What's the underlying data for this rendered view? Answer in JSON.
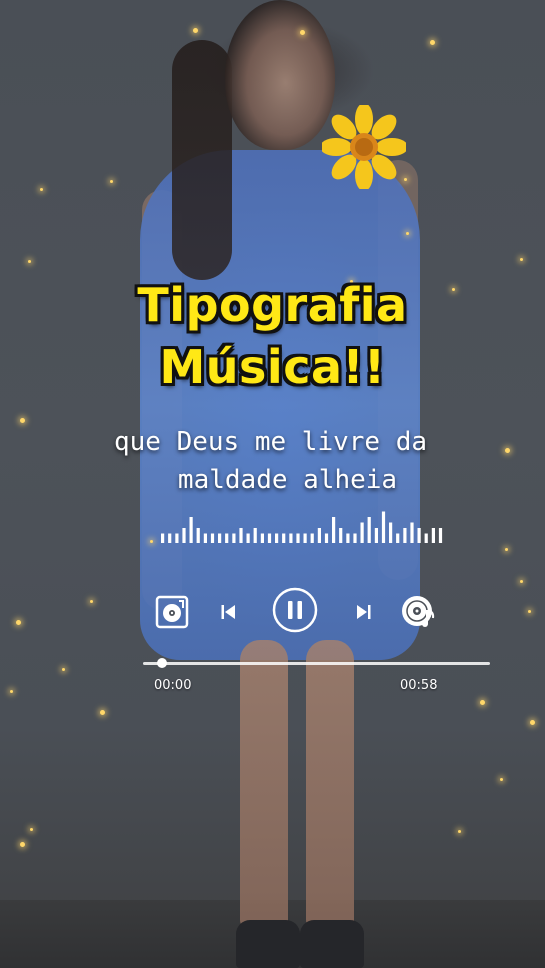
{
  "title": {
    "line1": "Tipografia",
    "line2": "Música!!",
    "color": "#ffe816"
  },
  "lyrics": {
    "line1": "que Deus me livre da",
    "line2": "maldade alheia"
  },
  "player": {
    "current_time": "00:00",
    "total_time": "00:58",
    "progress": 0.0,
    "state": "playing",
    "icons": {
      "left": "vinyl-record-icon",
      "prev": "skip-previous-icon",
      "play_pause": "pause-icon",
      "next": "skip-next-icon",
      "right": "music-disc-icon"
    }
  },
  "waveform": {
    "bars": [
      1,
      1,
      1,
      2,
      4,
      2,
      1,
      1,
      1,
      1,
      1,
      2,
      1,
      2,
      1,
      1,
      1,
      1,
      1,
      1,
      1,
      1,
      2,
      1,
      4,
      2,
      1,
      1,
      3,
      4,
      2,
      5,
      3,
      1,
      2,
      3,
      2,
      1,
      2,
      2
    ]
  },
  "colors": {
    "accent": "#ffe816",
    "text": "#ffffff",
    "sparkle": "#ffd76a"
  }
}
